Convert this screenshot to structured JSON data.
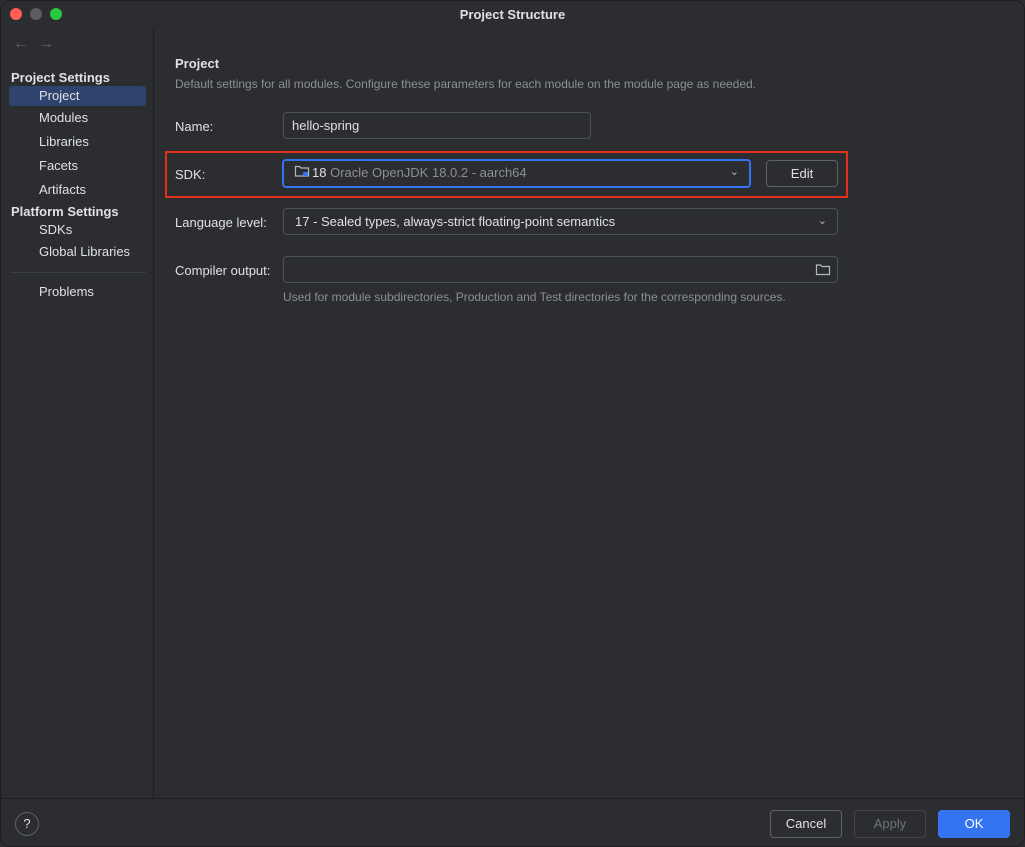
{
  "window": {
    "title": "Project Structure"
  },
  "nav": {
    "back_icon": "arrow-left-icon",
    "forward_icon": "arrow-right-icon"
  },
  "sidebar": {
    "project_settings_header": "Project Settings",
    "project_settings_items": [
      {
        "label": "Project",
        "selected": true
      },
      {
        "label": "Modules"
      },
      {
        "label": "Libraries"
      },
      {
        "label": "Facets"
      },
      {
        "label": "Artifacts"
      }
    ],
    "platform_settings_header": "Platform Settings",
    "platform_settings_items": [
      {
        "label": "SDKs"
      },
      {
        "label": "Global Libraries"
      }
    ],
    "problems_label": "Problems"
  },
  "main": {
    "title": "Project",
    "description": "Default settings for all modules. Configure these parameters for each module on the module page as needed.",
    "name": {
      "label": "Name:",
      "value": "hello-spring"
    },
    "sdk": {
      "label": "SDK:",
      "version": "18",
      "detail": "Oracle OpenJDK 18.0.2 - aarch64",
      "edit_label": "Edit"
    },
    "language_level": {
      "label": "Language level:",
      "value": "17 - Sealed types, always-strict floating-point semantics"
    },
    "compiler_output": {
      "label": "Compiler output:",
      "value": "",
      "hint": "Used for module subdirectories, Production and Test directories for the corresponding sources."
    }
  },
  "footer": {
    "help_label": "?",
    "cancel_label": "Cancel",
    "apply_label": "Apply",
    "ok_label": "OK"
  },
  "colors": {
    "accent": "#3574f0",
    "highlight": "#e0321b",
    "selected_bg": "#2e436e"
  }
}
